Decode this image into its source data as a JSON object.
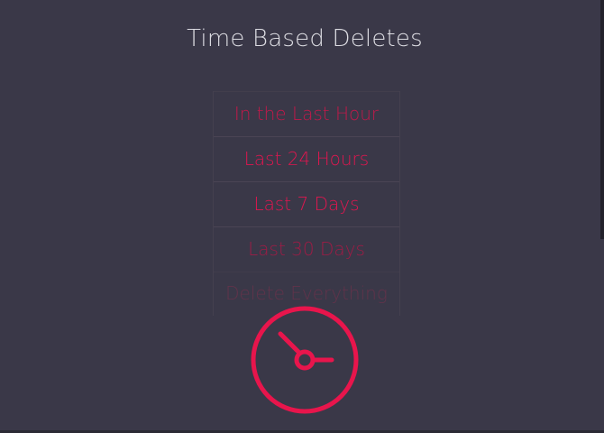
{
  "header": {
    "title": "Time Based Deletes"
  },
  "options": [
    {
      "label": "In the Last Hour"
    },
    {
      "label": "Last 24 Hours"
    },
    {
      "label": "Last 7 Days"
    },
    {
      "label": "Last 30 Days"
    },
    {
      "label": "Delete Everything"
    }
  ],
  "icons": {
    "clock": "clock-icon"
  },
  "colors": {
    "background": "#3a3848",
    "accent": "#e0164f",
    "title": "#dcdce2"
  }
}
